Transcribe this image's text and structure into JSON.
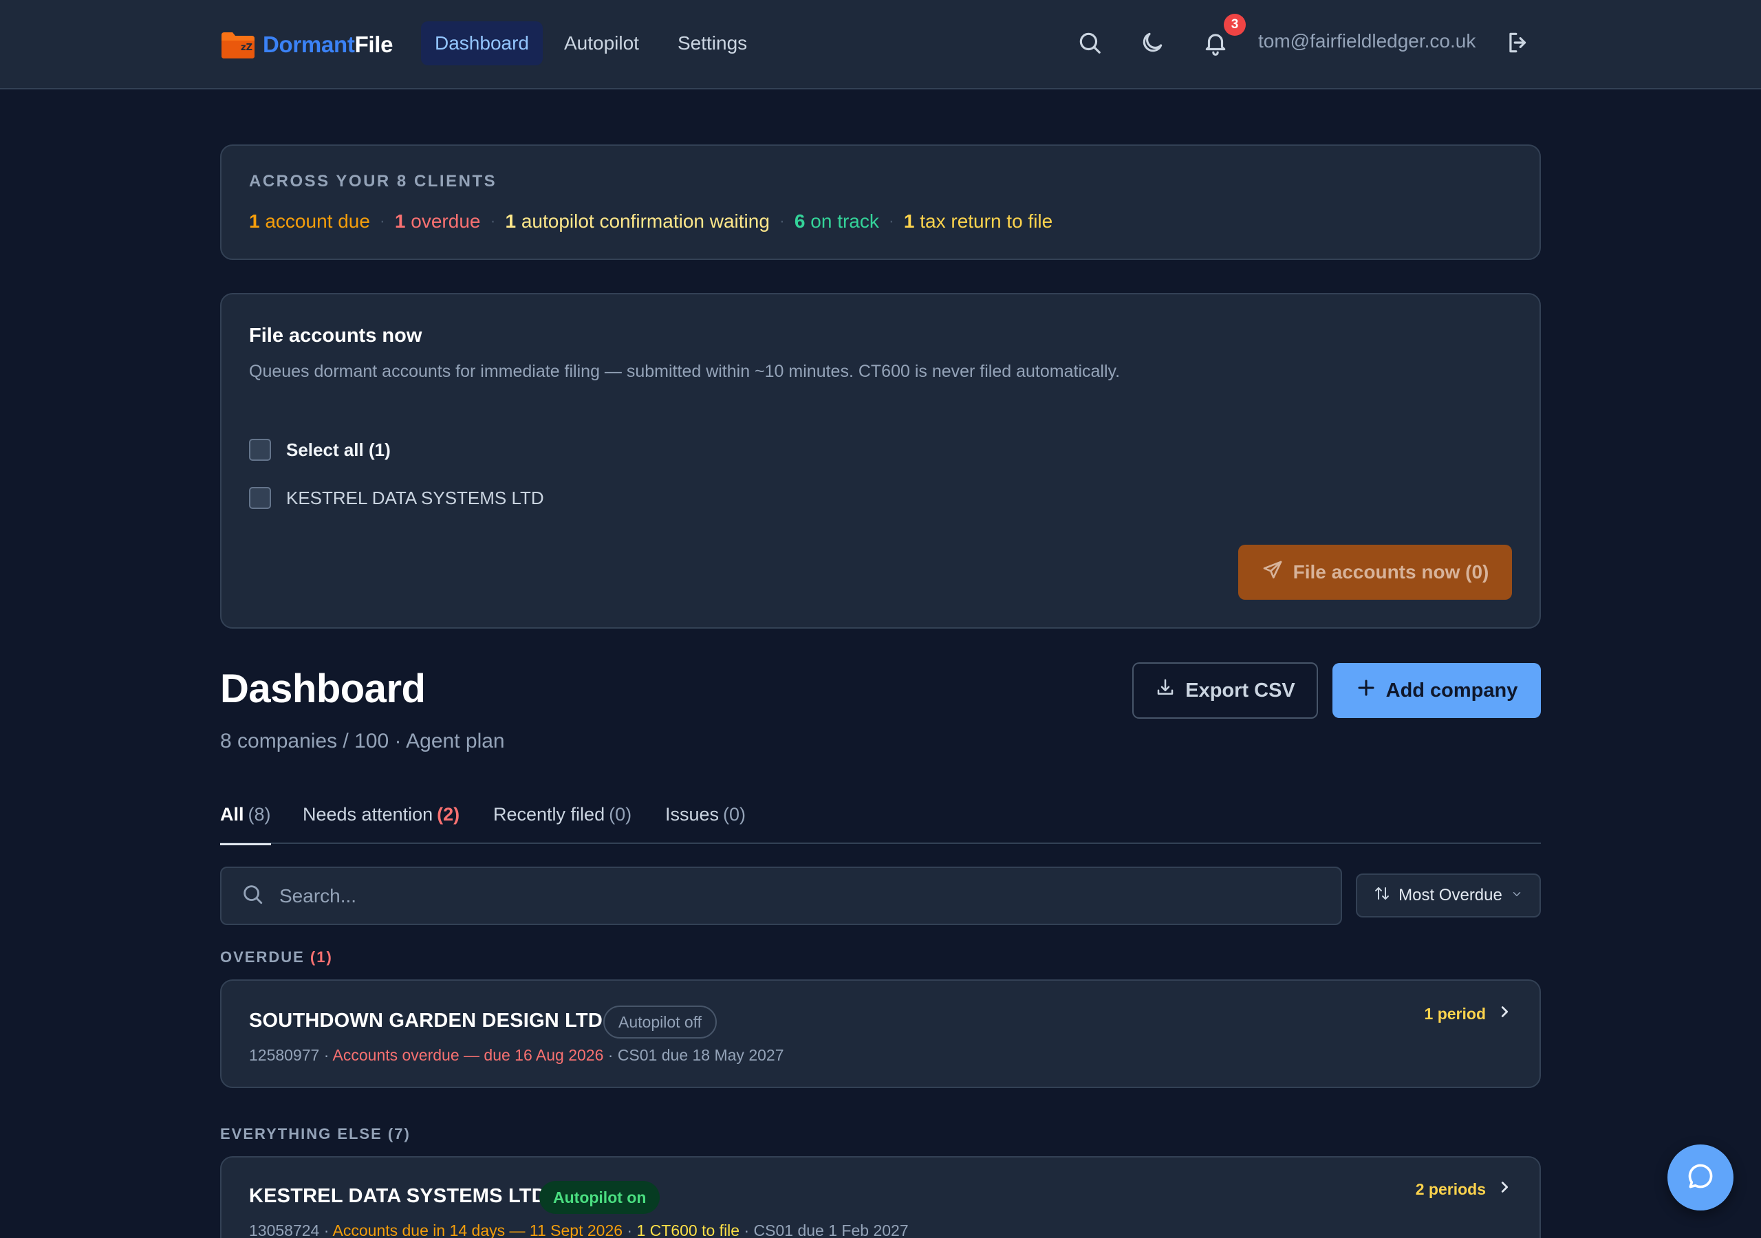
{
  "header": {
    "logo_word_1": "Dormant",
    "logo_word_2": "File",
    "logo_icon": "folder-icon",
    "nav": [
      {
        "label": "Dashboard",
        "active": true
      },
      {
        "label": "Autopilot",
        "active": false
      },
      {
        "label": "Settings",
        "active": false
      }
    ],
    "icons": [
      "search-icon",
      "moon-icon",
      "bell-icon",
      "logout-icon"
    ],
    "notification_count": "3",
    "user_email": "tom@fairfieldledger.co.uk"
  },
  "summary": {
    "title": "ACROSS YOUR 8 CLIENTS",
    "items": [
      {
        "num": "1",
        "text": " account due",
        "color": "#f59e0b"
      },
      {
        "num": "1",
        "text": " overdue",
        "color": "#f87171"
      },
      {
        "num": "1",
        "text": " autopilot confirmation waiting",
        "color": "#fde68a"
      },
      {
        "num": "6",
        "text": " on track",
        "color": "#34d399"
      },
      {
        "num": "1",
        "text": " tax return to file",
        "color": "#fcd34d"
      }
    ]
  },
  "file_accounts": {
    "title": "File accounts now",
    "description": "Queues dormant accounts for immediate filing — submitted within ~10 minutes. CT600 is never filed automatically.",
    "select_all_label": "Select all (1)",
    "companies": [
      "KESTREL DATA SYSTEMS LTD"
    ],
    "button_label": "File accounts now (0)"
  },
  "dashboard": {
    "title": "Dashboard",
    "subtitle": "8 companies / 100 · Agent plan",
    "export_label": "Export CSV",
    "add_label": "Add company"
  },
  "tabs": [
    {
      "label": "All",
      "count": "(8)",
      "active": true
    },
    {
      "label": "Needs attention",
      "count": "(2)",
      "active": false,
      "alert": true
    },
    {
      "label": "Recently filed",
      "count": "(0)",
      "active": false
    },
    {
      "label": "Issues",
      "count": "(0)",
      "active": false
    }
  ],
  "search": {
    "placeholder": "Search...",
    "value": ""
  },
  "sort": {
    "label": "Most Overdue"
  },
  "groups": {
    "overdue": {
      "label": "OVERDUE",
      "count": "(1)"
    },
    "everything_else": {
      "label": "EVERYTHING ELSE",
      "count": "(7)"
    }
  },
  "companies": [
    {
      "name": "SOUTHDOWN GARDEN DESIGN LTD",
      "badge": "Autopilot off",
      "number": "12580977",
      "sep": " · ",
      "accounts_status": "Accounts overdue — due 16 Aug 2026",
      "cs01": "CS01 due 18 May 2027",
      "periods": "1 period"
    },
    {
      "name": "KESTREL DATA SYSTEMS LTD",
      "badge": "Autopilot on",
      "number": "13058724",
      "sep": " · ",
      "accounts_status": "Accounts due in 14 days — 11 Sept 2026",
      "ct600": "1 CT600 to file",
      "cs01": "CS01 due 1 Feb 2027",
      "periods": "2 periods"
    }
  ],
  "colors": {
    "bg": "#0f172a",
    "card": "#1e293b",
    "accent": "#60a5fa",
    "brand_orange": "#f97316"
  }
}
